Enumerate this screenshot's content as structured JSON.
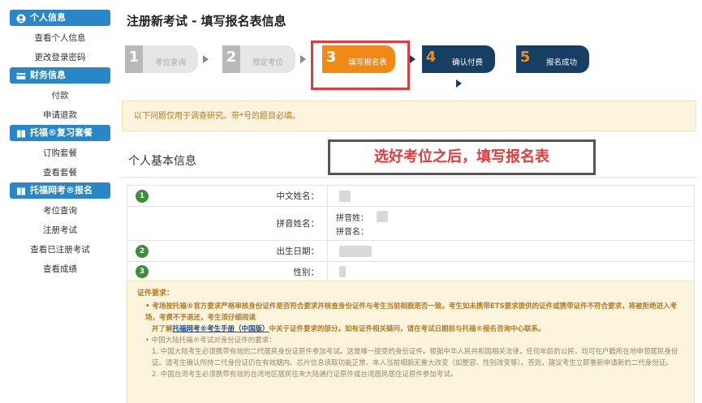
{
  "sidebar": {
    "sections": [
      {
        "title": "个人信息",
        "icon": "user-icon",
        "items": [
          "查看个人信息",
          "更改登录密码"
        ]
      },
      {
        "title": "财务信息",
        "icon": "card-icon",
        "items": [
          "付款",
          "申请退款"
        ]
      },
      {
        "title": "托福®复习套餐",
        "icon": "book-icon",
        "items": [
          "订购套餐",
          "查看套餐"
        ]
      },
      {
        "title": "托福网考®报名",
        "icon": "book-icon",
        "items": [
          "考位查询",
          "注册考试",
          "查看已注册考试",
          "查看成绩"
        ]
      }
    ]
  },
  "page": {
    "title": "注册新考试 - 填写报名表信息"
  },
  "steps": [
    {
      "num": "1",
      "label": "考位查询",
      "state": "done"
    },
    {
      "num": "2",
      "label": "预定考位",
      "state": "done"
    },
    {
      "num": "3",
      "label": "填写报名表",
      "state": "current"
    },
    {
      "num": "4",
      "label": "确认付费",
      "state": "todo"
    },
    {
      "num": "5",
      "label": "报名成功",
      "state": "todo"
    }
  ],
  "notice": {
    "before": "以下问题仅用于调查研究。带",
    "star": "*",
    "after": "号的题目必填。"
  },
  "section_title": "个人基本信息",
  "overlay_note": "选好考位之后，填写报名表",
  "form": {
    "rows": [
      {
        "idx": "1",
        "label": "中文姓名："
      },
      {
        "idx": "",
        "label": "拼音姓名：",
        "sub1": "拼音姓：",
        "sub2": "拼音名："
      },
      {
        "idx": "2",
        "label": "出生日期："
      },
      {
        "idx": "3",
        "label": "性别："
      }
    ]
  },
  "requirements": {
    "heading": "证件要求：",
    "p1": "• 考场按托福®官方要求严格审核身份证件是否符合要求并核查身份证件与考生当前相貌是否一致。考生如未携带ETS要求提供的证件或携带证件不符合要求，将被拒绝进入考场，考费不予退还，考生须仔细阅读",
    "p1b_pre": "并了解",
    "p1b_link": "托福网考®考生手册（中国版）",
    "p1b_post": "中关于证件要求的部分。如有证件相关疑问，请在考试日期前与托福®报名咨询中心联系。",
    "p2": "• 中国大陆托福®考试对身份证件的要求：",
    "p3": "1. 中国大陆考生必须携带有效的二代居民身份证原件参加考试。这是唯一接受的身份证件。根据中华人民共和国相关法律，任何年龄的公民，均可在户籍所在地申领居民身份证。请考生确认所持二代身份证仍在有效期内、芯片信息读取功能正常、本人当前相貌无重大改变（如整容、性别改变等）。否则，建议考生立即重新申请新的二代身份证。",
    "p4": "2. 中国台湾考生必须携带有效的台湾地区居民往来大陆通行证原件或台湾居民居住证原件参加考试。"
  }
}
